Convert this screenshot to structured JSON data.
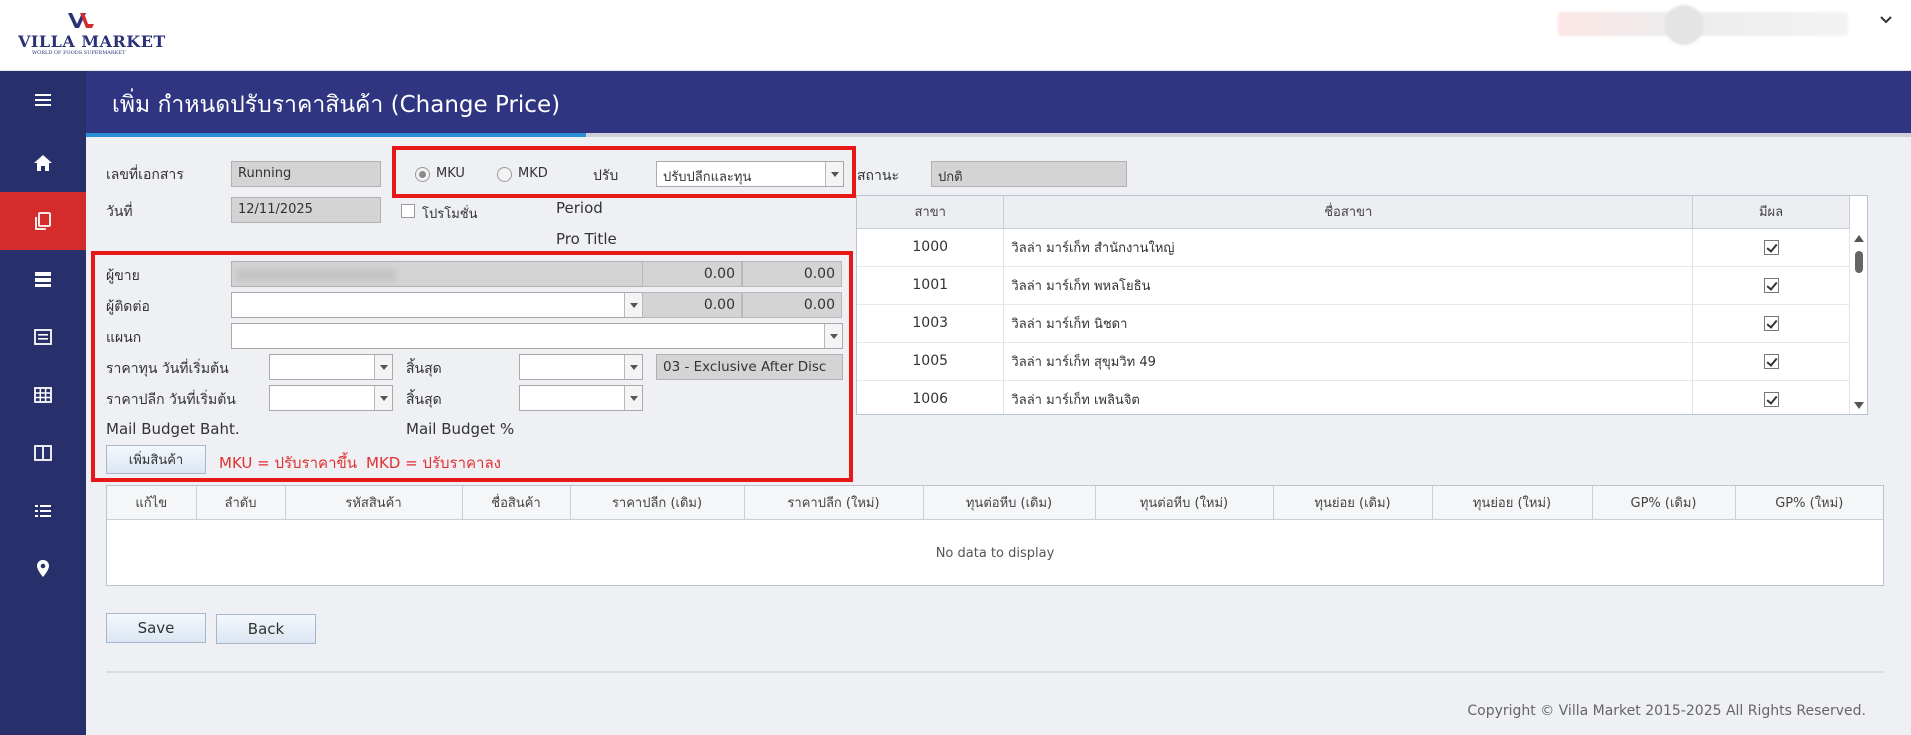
{
  "app": {
    "logo_text": "VILLA MARKET",
    "logo_sub": "WORLD OF FOODS SUPERMARKET"
  },
  "header": {
    "title": "เพิ่ม กำหนดปรับราคาสินค้า (Change Price)"
  },
  "sidebar": {
    "items": [
      {
        "name": "menu-icon"
      },
      {
        "name": "home-icon"
      },
      {
        "name": "documents-icon",
        "active": true
      },
      {
        "name": "server-icon"
      },
      {
        "name": "list-card-icon"
      },
      {
        "name": "table-icon"
      },
      {
        "name": "columns-icon"
      },
      {
        "name": "list-icon"
      },
      {
        "name": "location-icon"
      }
    ]
  },
  "form": {
    "doc_no_label": "เลขที่เอกสาร",
    "doc_no_value": "Running",
    "date_label": "วันที่",
    "date_value": "12/11/2025",
    "mku_label": "MKU",
    "mkd_label": "MKD",
    "adjust_label": "ปรับ",
    "adjust_value": "ปรับปลีกและทุน",
    "status_label": "สถานะ",
    "status_value": "ปกติ",
    "promo_label": "โปรโมชั่น",
    "period_label": "Period",
    "pro_title_label": "Pro Title",
    "vendor_label": "ผู้ขาย",
    "vendor_num1": "0.00",
    "vendor_num2": "0.00",
    "contact_label": "ผู้ติดต่อ",
    "contact_num1": "0.00",
    "contact_num2": "0.00",
    "dept_label": "แผนก",
    "cost_start_label": "ราคาทุน วันที่เริ่มต้น",
    "cost_end_label": "สิ้นสุด",
    "cost_type_value": "03 - Exclusive After Disc",
    "retail_start_label": "ราคาปลีก วันที่เริ่มต้น",
    "retail_end_label": "สิ้นสุด",
    "mail_budget_baht_label": "Mail Budget Baht.",
    "mail_budget_pct_label": "Mail Budget %",
    "add_product_label": "เพิ่มสินค้า",
    "mku_note": "MKU = ปรับราคาขึ้น",
    "mkd_note": "MKD = ปรับราคาลง"
  },
  "branches": {
    "headers": [
      "สาขา",
      "ชื่อสาขา",
      "มีผล"
    ],
    "rows": [
      {
        "code": "1000",
        "name": "วิลล่า มาร์เก็ท สำนักงานใหญ่",
        "active": true
      },
      {
        "code": "1001",
        "name": "วิลล่า มาร์เก็ท พหลโยธิน",
        "active": true
      },
      {
        "code": "1003",
        "name": "วิลล่า มาร์เก็ท นิชดา",
        "active": true
      },
      {
        "code": "1005",
        "name": "วิลล่า มาร์เก็ท สุขุมวิท 49",
        "active": true
      },
      {
        "code": "1006",
        "name": "วิลล่า มาร์เก็ท เพลินจิต",
        "active": true
      }
    ]
  },
  "products": {
    "headers": [
      "แก้ไข",
      "ลำดับ",
      "รหัสสินค้า",
      "ชื่อสินค้า",
      "ราคาปลีก (เดิม)",
      "ราคาปลีก (ใหม่)",
      "ทุนต่อหีบ (เดิม)",
      "ทุนต่อหีบ (ใหม่)",
      "ทุนย่อย (เดิม)",
      "ทุนย่อย (ใหม่)",
      "GP% (เดิม)",
      "GP% (ใหม่)"
    ],
    "empty_text": "No data to display"
  },
  "actions": {
    "save_label": "Save",
    "back_label": "Back"
  },
  "footer": {
    "copyright": "Copyright © Villa Market 2015-2025 All Rights Reserved."
  },
  "colors": {
    "sidebar": "#27306b",
    "header": "#2f3580",
    "active": "#d42b2b",
    "highlight": "#e81818"
  }
}
